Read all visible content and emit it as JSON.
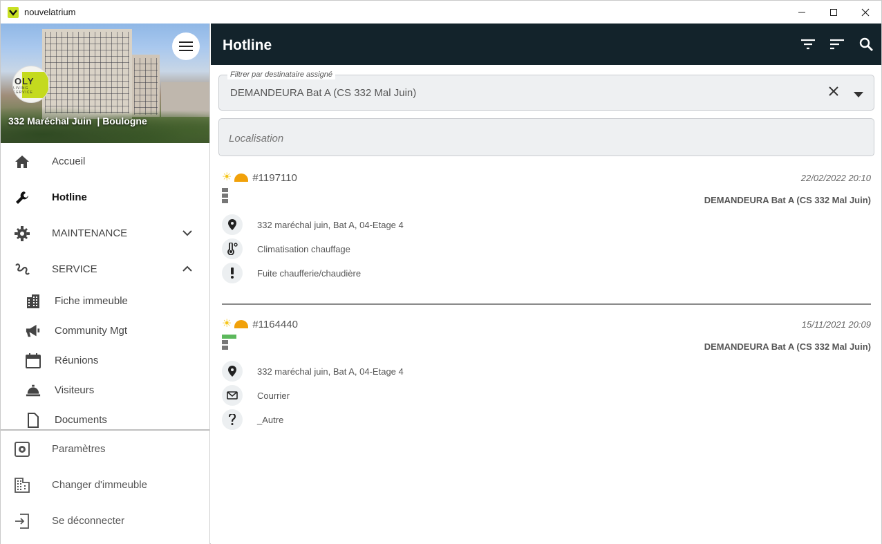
{
  "window": {
    "title": "nouvelatrium",
    "minimize": "–",
    "maximize": "□",
    "close": "✕"
  },
  "sidebar": {
    "building_name": "332 Maréchal Juin  | Boulogne",
    "logo_text": "OLY",
    "logo_subtext": "LIVING SERVICE",
    "menu_icon": "hamburger-icon",
    "nav": [
      {
        "label": "Accueil",
        "icon": "home-icon"
      },
      {
        "label": "Hotline",
        "icon": "wrench-icon",
        "active": true
      },
      {
        "label": "MAINTENANCE",
        "icon": "gear-icon",
        "expanded": false
      },
      {
        "label": "SERVICE",
        "icon": "service-icon",
        "expanded": true
      }
    ],
    "service_items": [
      {
        "label": "Fiche immeuble",
        "icon": "building-icon"
      },
      {
        "label": "Community Mgt",
        "icon": "megaphone-icon"
      },
      {
        "label": "Réunions",
        "icon": "calendar-icon"
      },
      {
        "label": "Visiteurs",
        "icon": "concierge-bell-icon"
      },
      {
        "label": "Documents",
        "icon": "document-icon"
      }
    ],
    "footer": [
      {
        "label": "Paramètres",
        "icon": "settings-icon"
      },
      {
        "label": "Changer d'immeuble",
        "icon": "building-switch-icon"
      },
      {
        "label": "Se déconnecter",
        "icon": "logout-icon"
      }
    ]
  },
  "appbar": {
    "title": "Hotline",
    "actions": [
      "filter-icon",
      "sort-icon",
      "search-icon"
    ]
  },
  "filters": {
    "assignee_label": "Filtrer par destinataire assigné",
    "assignee_value": "DEMANDEURA Bat A (CS 332 Mal Juin)",
    "location_placeholder": "Localisation"
  },
  "tickets": [
    {
      "number": "#1197110",
      "date": "22/02/2022 20:10",
      "requester": "DEMANDEURA Bat A (CS 332 Mal Juin)",
      "status_progress": 0,
      "rows": [
        {
          "icon": "location-pin-icon",
          "text": "332 maréchal juin, Bat A, 04-Etage 4"
        },
        {
          "icon": "thermometer-icon",
          "text": "Climatisation chauffage"
        },
        {
          "icon": "exclamation-icon",
          "text": "Fuite chaufferie/chaudière"
        }
      ]
    },
    {
      "number": "#1164440",
      "date": "15/11/2021 20:09",
      "requester": "DEMANDEURA Bat A (CS 332 Mal Juin)",
      "status_progress": 1,
      "rows": [
        {
          "icon": "location-pin-icon",
          "text": "332 maréchal juin, Bat A, 04-Etage 4"
        },
        {
          "icon": "envelope-icon",
          "text": "Courrier"
        },
        {
          "icon": "question-icon",
          "text": "_Autre"
        }
      ]
    }
  ],
  "colors": {
    "appbar": "#13232b",
    "accent_green": "#5cb85c",
    "priority_orange": "#f1a10a",
    "sun_yellow": "#f5c518"
  }
}
